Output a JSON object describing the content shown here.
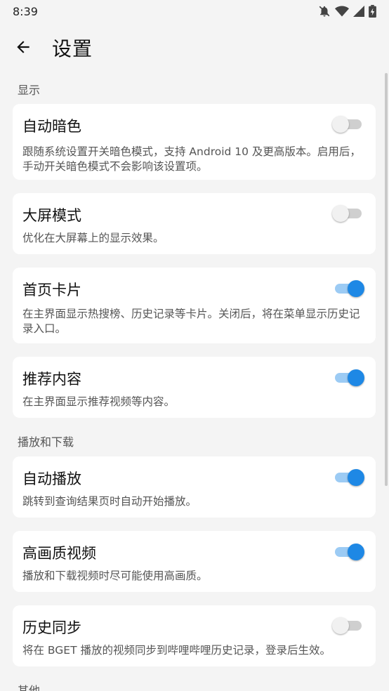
{
  "status_bar": {
    "time": "8:39",
    "icons": [
      "bell-off-icon",
      "wifi-icon",
      "signal-icon",
      "battery-charging-icon"
    ]
  },
  "app_bar": {
    "back_icon": "arrow-left-icon",
    "title": "设置"
  },
  "sections": [
    {
      "header": "显示"
    },
    {
      "header": "播放和下载"
    },
    {
      "header": "其他"
    }
  ],
  "settings": [
    {
      "title": "自动暗色",
      "desc": "跟随系统设置开关暗色模式，支持 Android 10 及更高版本。启用后，手动开关暗色模式不会影响该设置项。",
      "enabled": false
    },
    {
      "title": "大屏模式",
      "desc": "优化在大屏幕上的显示效果。",
      "enabled": false
    },
    {
      "title": "首页卡片",
      "desc": "在主界面显示热搜榜、历史记录等卡片。关闭后，将在菜单显示历史记录入口。",
      "enabled": true
    },
    {
      "title": "推荐内容",
      "desc": "在主界面显示推荐视频等内容。",
      "enabled": true
    },
    {
      "title": "自动播放",
      "desc": "跳转到查询结果页时自动开始播放。",
      "enabled": true
    },
    {
      "title": "高画质视频",
      "desc": "播放和下载视频时尽可能使用高画质。",
      "enabled": true
    },
    {
      "title": "历史同步",
      "desc": "将在 BGET 播放的视频同步到哔哩哔哩历史记录，登录后生效。",
      "enabled": false
    }
  ],
  "colors": {
    "accent": "#1e88e5",
    "accent_track": "#9ccbf4",
    "background": "#f4f4f4",
    "card": "#ffffff"
  }
}
